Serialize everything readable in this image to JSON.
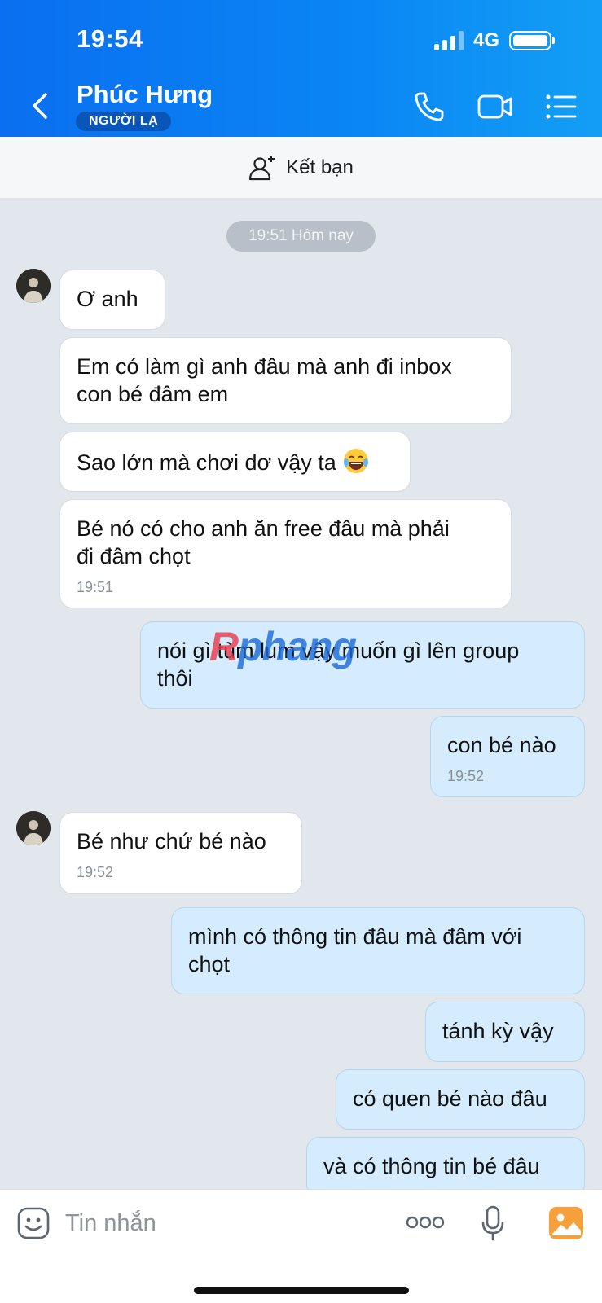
{
  "status_bar": {
    "time": "19:54",
    "network": "4G",
    "signal_bars": 3
  },
  "header": {
    "contact_name": "Phúc Hưng",
    "badge": "NGƯỜI LẠ",
    "icons": [
      "back-chevron-icon",
      "phone-icon",
      "video-camera-icon",
      "menu-list-icon"
    ]
  },
  "friend_bar": {
    "label": "Kết bạn",
    "icon": "add-friend-icon"
  },
  "chat": {
    "date_separator": "19:51 Hôm nay",
    "messages": [
      {
        "dir": "in",
        "text": "Ơ anh"
      },
      {
        "dir": "in",
        "line1": "Em có làm gì anh đâu mà anh đi inbox",
        "line2": "con bé đâm em"
      },
      {
        "dir": "in",
        "text": "Sao lớn mà chơi dơ vậy ta",
        "emoji": "laughing-tears-emoji"
      },
      {
        "dir": "in",
        "line1": "Bé nó có cho anh ăn free đâu mà phải",
        "line2": "đi đâm chọt",
        "time": "19:51"
      },
      {
        "dir": "out",
        "line1": "nói gì tùm lum vậy muốn gì lên group",
        "line2": "thôi"
      },
      {
        "dir": "out",
        "text": "con bé nào",
        "time": "19:52"
      },
      {
        "dir": "in",
        "text": "Bé như chứ bé nào",
        "time": "19:52"
      },
      {
        "dir": "out",
        "line1": "mình có thông tin đâu mà đâm với",
        "line2": "chọt"
      },
      {
        "dir": "out",
        "text": "tánh kỳ vậy"
      },
      {
        "dir": "out",
        "text": "có quen bé nào đâu"
      },
      {
        "dir": "out",
        "text": "và có thông tin bé đâu"
      }
    ]
  },
  "watermark": {
    "first": "R",
    "rest": "phang"
  },
  "input_bar": {
    "placeholder": "Tin nhắn",
    "icons": [
      "sticker-icon",
      "more-dots-icon",
      "microphone-icon",
      "image-gallery-icon"
    ]
  },
  "colors": {
    "header_start": "#0a6ff0",
    "header_end": "#139ff5",
    "outgoing_bubble": "#d4ecfd",
    "chat_bg": "#e2e7ee",
    "gallery_orange": "#f5a03a"
  }
}
